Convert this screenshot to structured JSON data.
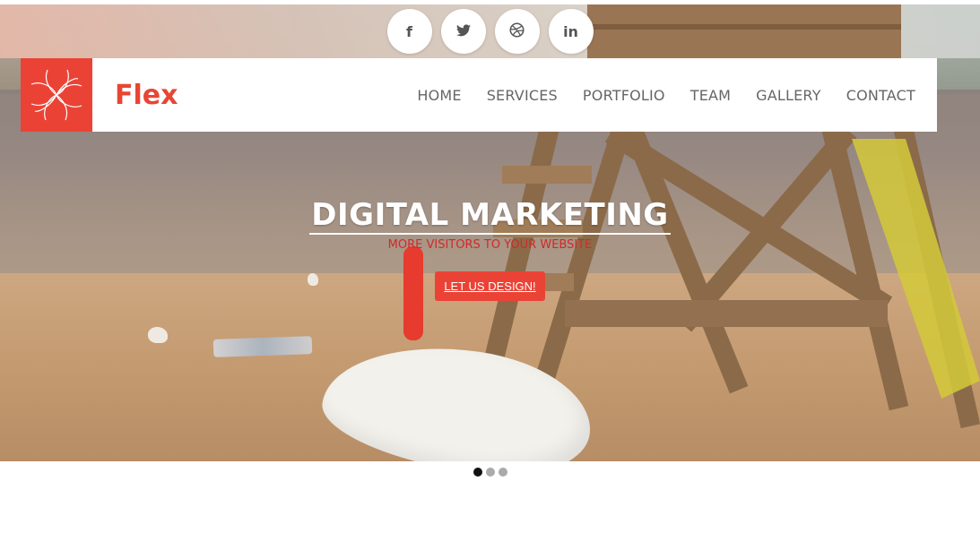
{
  "social": [
    {
      "icon": "facebook-icon",
      "glyph": "f"
    },
    {
      "icon": "twitter-icon",
      "glyph": "🐦"
    },
    {
      "icon": "dribbble-icon",
      "glyph": "⊛"
    },
    {
      "icon": "linkedin-icon",
      "glyph": "in"
    }
  ],
  "brand": {
    "name": "Flex",
    "color": "#e84534"
  },
  "menu": [
    "HOME",
    "SERVICES",
    "PORTFOLIO",
    "TEAM",
    "GALLERY",
    "CONTACT"
  ],
  "hero": {
    "title": "DIGITAL MARKETING",
    "subtitle": "MORE VISITORS TO YOUR WEBSITE",
    "cta_label": "LET US DESIGN!"
  },
  "slider": {
    "slides": 3,
    "active": 1
  },
  "colors": {
    "accent": "#ea4336",
    "subtitle": "#cf2a2a"
  }
}
